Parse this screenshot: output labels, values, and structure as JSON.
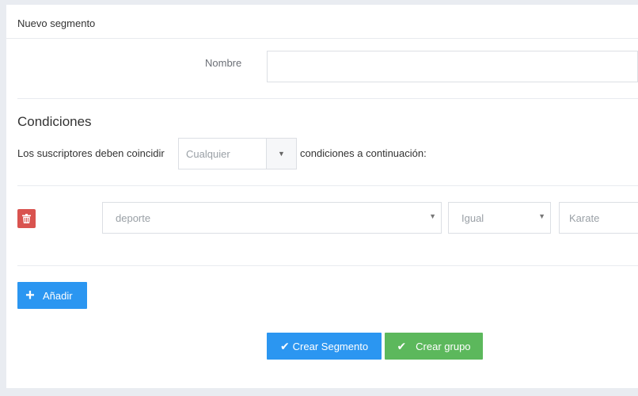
{
  "header": {
    "title": "Nuevo segmento"
  },
  "form": {
    "name_label": "Nombre",
    "name_value": ""
  },
  "conditions": {
    "title": "Condiciones",
    "match_prefix": "Los suscriptores deben coincidir",
    "match_value": "Cualquier",
    "match_suffix": "condiciones a continuación:",
    "rows": [
      {
        "field": "deporte",
        "operator": "Igual",
        "value_placeholder": "Karate"
      }
    ]
  },
  "actions": {
    "add_label": "Añadir",
    "create_segment_label": "Crear Segmento",
    "create_group_label": "Crear grupo"
  },
  "colors": {
    "primary": "#2b96f1",
    "success": "#5cb85c",
    "danger": "#d9534f"
  },
  "icons": [
    "trash-icon",
    "plus-icon",
    "check-icon",
    "caret-down-icon"
  ]
}
